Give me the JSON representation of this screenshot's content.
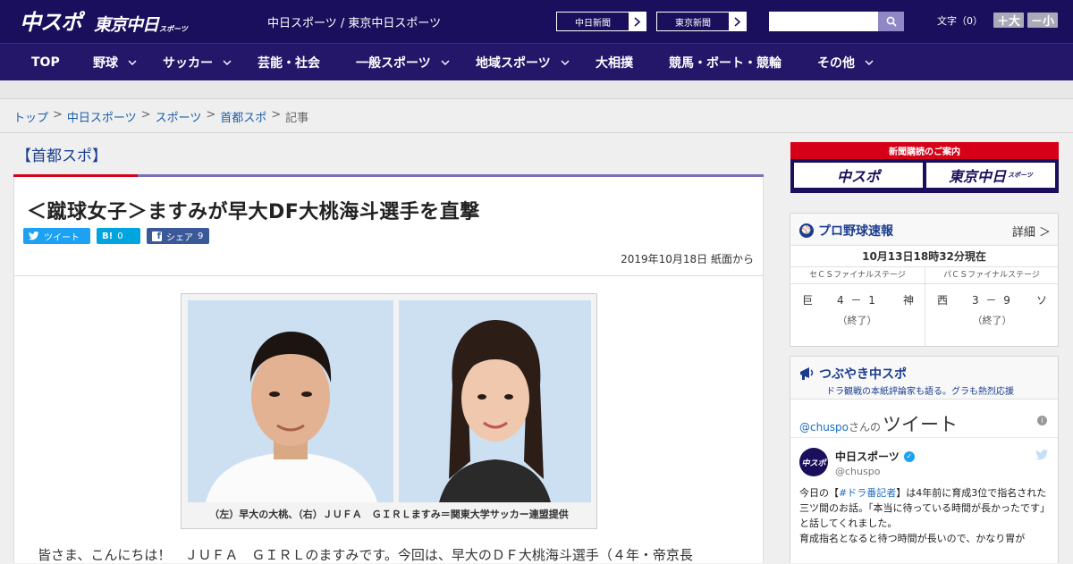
{
  "header": {
    "logo_main": "中スポ",
    "logo_tokyo": "東京中日",
    "logo_small": "スポーツ",
    "site_title": "中日スポーツ / 東京中日スポーツ",
    "paper_links": [
      "中日新聞",
      "東京新聞"
    ],
    "search": {
      "value": "",
      "placeholder": ""
    },
    "font_label": "文字（0）",
    "font_bigger": "＋大",
    "font_smaller": "－小"
  },
  "nav": {
    "items": [
      {
        "label": "TOP",
        "dropdown": false
      },
      {
        "label": "野球",
        "dropdown": true
      },
      {
        "label": "サッカー",
        "dropdown": true
      },
      {
        "label": "芸能・社会",
        "dropdown": false
      },
      {
        "label": "一般スポーツ",
        "dropdown": true
      },
      {
        "label": "地域スポーツ",
        "dropdown": true
      },
      {
        "label": "大相撲",
        "dropdown": false
      },
      {
        "label": "競馬・ボート・競輪",
        "dropdown": false
      },
      {
        "label": "その他",
        "dropdown": true
      }
    ]
  },
  "breadcrumb": {
    "items": [
      "トップ",
      "中日スポーツ",
      "スポーツ",
      "首都スポ",
      "記事"
    ],
    "separator": ">"
  },
  "article": {
    "section": "【首都スポ】",
    "headline": "＜蹴球女子＞ますみが早大DF大桃海斗選手を直撃",
    "share": {
      "twitter": "ツイート",
      "hatena_icon": "B!",
      "hatena_count": "0",
      "facebook": "シェア",
      "facebook_count": "9"
    },
    "date": "2019年10月18日 紙面から",
    "caption": "（左）早大の大桃、（右）ＪＵＦＡ　ＧＩＲＬますみ＝関東大学サッカー連盟提供",
    "body_first_line": "皆さま、こんにちは！　ＪＵＦＡ　ＧＩＲＬのますみです。今回は、早大のＤＦ大桃海斗選手（４年・帝京長"
  },
  "sidebar": {
    "subscribe": {
      "title": "新聞購読のご案内",
      "btn_chuspo": "中スポ",
      "btn_tokyo": "東京中日",
      "btn_tokyo_small": "スポーツ"
    },
    "baseball": {
      "title": "プロ野球速報",
      "more": "詳細 ＞",
      "time": "10月13日18時32分現在",
      "games": [
        {
          "stage": "セＣＳファイナルステージ",
          "home": "巨",
          "score": "4 － 1",
          "away": "神",
          "status": "（終了）"
        },
        {
          "stage": "パＣＳファイナルステージ",
          "home": "西",
          "score": "3 － 9",
          "away": "ソ",
          "status": "（終了）"
        }
      ]
    },
    "twitter": {
      "title": "つぶやき中スポ",
      "subtitle": "ドラ観戦の本紙評論家も語る。グラも熱烈応援",
      "handle": "@chuspo",
      "handle_suffix": "さんの",
      "tweets_label": "ツイート",
      "account_name": "中日スポーツ",
      "account_user": "@chuspo",
      "avatar_text": "中スポ",
      "tweet_pre": "今日の【",
      "tweet_hashtag": "#ドラ番記者",
      "tweet_post": "】は4年前に育成3位で指名された三ツ間のお話。「本当に待っている時間が長かったです」と話してくれました。",
      "tweet_line2": "育成指名となると待つ時間が長いので、かなり胃が"
    }
  },
  "colors": {
    "header_bg": "#1a0f5c",
    "nav_bg": "#24176a",
    "accent_red": "#d60018",
    "link_blue": "#1a5fa8",
    "twitter_blue": "#1da1f2",
    "hatena_blue": "#00a4de",
    "facebook_blue": "#3b5998"
  }
}
